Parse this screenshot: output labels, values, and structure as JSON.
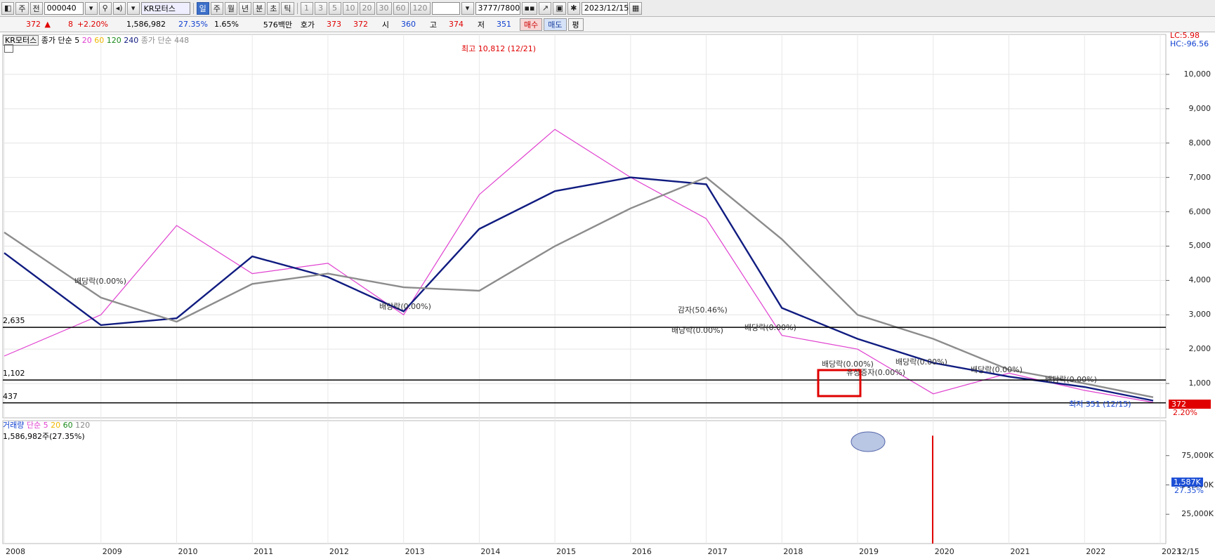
{
  "toolbar": {
    "period_first": "주",
    "mode": "전",
    "code": "000040",
    "stock_name": "KR모터스",
    "periods": [
      "일",
      "주",
      "월",
      "년",
      "분",
      "초",
      "틱"
    ],
    "selected_period": "일",
    "intervals": [
      "1",
      "3",
      "5",
      "10",
      "20",
      "30",
      "60",
      "120"
    ],
    "count": "3777",
    "count_total": "/7800",
    "date": "2023/12/15"
  },
  "quote": {
    "price": "372",
    "change": "8",
    "change_pct": "+2.20%",
    "volume": "1,586,982",
    "turnover_pct": "27.35%",
    "ratio": "1.65%",
    "amount": "576백만",
    "hoga_label": "호가",
    "hoga1": "373",
    "hoga2": "372",
    "open_label": "시",
    "open": "360",
    "high_label": "고",
    "high": "374",
    "low_label": "저",
    "low": "351",
    "buy_label": "매수",
    "sell_label": "매도",
    "avg_label": "평"
  },
  "legend_price": {
    "name": "KR모터스",
    "ma_label": "종가 단순 5",
    "ma20": "20",
    "ma60": "60",
    "ma120": "120",
    "ma240": "240",
    "ma448": "종가 단순 448"
  },
  "legend_volume": {
    "title": "거래량",
    "ma_label": "단순 5",
    "ma20": "20",
    "ma60": "60",
    "ma120": "120",
    "current": "1,586,982주(27.35%)"
  },
  "right_info": {
    "lc": "LC:5.98",
    "hc": "HC:-96.56"
  },
  "colors": {
    "ma5": "#e040d0",
    "ma20": "#f0b800",
    "ma60": "#1a8a1a",
    "ma120": "#101c80",
    "ma240": "#8c8c8c",
    "up": "#e00000",
    "down": "#1040d0"
  },
  "annotations": {
    "high_mark": "최고 10,812 (12/21)",
    "low_mark": "최저 351 (12/15)",
    "line1": "2,635",
    "line2": "1,102",
    "line3": "437",
    "price_tag": "372",
    "pct_tag": "2.20%",
    "div1": "배당락(0.00%)",
    "div2": "배당락(0.00%)",
    "gamja": "감자(50.46%)",
    "div3": "배당락(0.00%)",
    "div4": "배당락(0.00%)",
    "div5": "배당락(0.00%)",
    "div6": "배당락(0.00%)",
    "div7": "배당락(0.00%)",
    "div8": "배당락(0.00%)",
    "inc": "유상증자(0.00%)"
  },
  "chart_data": {
    "type": "line",
    "title": "KR모터스",
    "x": [
      "2008",
      "2009",
      "2010",
      "2011",
      "2012",
      "2013",
      "2014",
      "2015",
      "2016",
      "2017",
      "2018",
      "2019",
      "2020",
      "2021",
      "2022",
      "2023"
    ],
    "x_end_label": "12/15",
    "ylim": [
      0,
      11000
    ],
    "y_ticks": [
      "1,000",
      "2,000",
      "3,000",
      "4,000",
      "5,000",
      "6,000",
      "7,000",
      "8,000",
      "9,000",
      "10,000"
    ],
    "series": [
      {
        "name": "5",
        "values": [
          1800,
          3000,
          5600,
          4200,
          4500,
          3000,
          6500,
          8400,
          7000,
          5800,
          2400,
          2000,
          700,
          1300,
          800,
          450
        ]
      },
      {
        "name": "240",
        "values": [
          4800,
          2700,
          2900,
          4700,
          4100,
          3100,
          5500,
          6600,
          7000,
          6800,
          3200,
          2300,
          1600,
          1200,
          900,
          500
        ]
      },
      {
        "name": "448",
        "values": [
          5400,
          3500,
          2800,
          3900,
          4200,
          3800,
          3700,
          5000,
          6100,
          7000,
          5200,
          3000,
          2300,
          1400,
          1000,
          600
        ]
      }
    ],
    "horizontal_lines": [
      2635,
      1102,
      437
    ],
    "volume_ticks": [
      "25,000K",
      "50,000K",
      "75,000K"
    ],
    "volume_current": "1,587K",
    "volume_pct": "27.35%"
  }
}
